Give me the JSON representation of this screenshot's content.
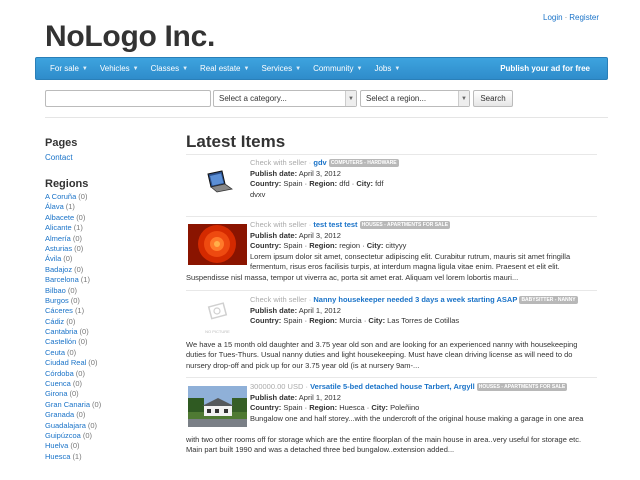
{
  "header": {
    "login": "Login",
    "register": "Register",
    "brand": "NoLogo Inc."
  },
  "nav": {
    "items": [
      "For sale",
      "Vehicles",
      "Classes",
      "Real estate",
      "Services",
      "Community",
      "Jobs"
    ],
    "publish": "Publish your ad for free"
  },
  "search": {
    "query": "",
    "category_placeholder": "Select a category...",
    "region_placeholder": "Select a region...",
    "button": "Search"
  },
  "sidebar": {
    "pages_heading": "Pages",
    "contact": "Contact",
    "regions_heading": "Regions",
    "regions": [
      {
        "name": "A Coruña",
        "count": "(0)"
      },
      {
        "name": "Álava",
        "count": "(1)"
      },
      {
        "name": "Albacete",
        "count": "(0)"
      },
      {
        "name": "Alicante",
        "count": "(1)"
      },
      {
        "name": "Almería",
        "count": "(0)"
      },
      {
        "name": "Asturias",
        "count": "(0)"
      },
      {
        "name": "Ávila",
        "count": "(0)"
      },
      {
        "name": "Badajoz",
        "count": "(0)"
      },
      {
        "name": "Barcelona",
        "count": "(1)"
      },
      {
        "name": "Bilbao",
        "count": "(0)"
      },
      {
        "name": "Burgos",
        "count": "(0)"
      },
      {
        "name": "Cáceres",
        "count": "(1)"
      },
      {
        "name": "Cádiz",
        "count": "(0)"
      },
      {
        "name": "Cantabria",
        "count": "(0)"
      },
      {
        "name": "Castellón",
        "count": "(0)"
      },
      {
        "name": "Ceuta",
        "count": "(0)"
      },
      {
        "name": "Ciudad Real",
        "count": "(0)"
      },
      {
        "name": "Córdoba",
        "count": "(0)"
      },
      {
        "name": "Cuenca",
        "count": "(0)"
      },
      {
        "name": "Girona",
        "count": "(0)"
      },
      {
        "name": "Gran Canaria",
        "count": "(0)"
      },
      {
        "name": "Granada",
        "count": "(0)"
      },
      {
        "name": "Guadalajara",
        "count": "(0)"
      },
      {
        "name": "Guipúzcoa",
        "count": "(0)"
      },
      {
        "name": "Huelva",
        "count": "(0)"
      },
      {
        "name": "Huesca",
        "count": "(1)"
      }
    ]
  },
  "main": {
    "title": "Latest Items",
    "labels": {
      "publish_date": "Publish date:",
      "country": "Country:",
      "region": "Region:",
      "city": "City:"
    },
    "items": [
      {
        "price": "Check with seller",
        "title": "gdv",
        "category": "COMPUTERS - HARDWARE",
        "date": "April 3, 2012",
        "country": "Spain",
        "region": "dfd",
        "city": "fdf",
        "desc": "dvxv",
        "image": "laptop-photo"
      },
      {
        "price": "Check with seller",
        "title": "test test test",
        "category": "HOUSES - APARTMENTS FOR SALE",
        "date": "April 3, 2012",
        "country": "Spain",
        "region": "region",
        "city": "cittyyy",
        "desc_inline": "Lorem ipsum dolor sit amet, consectetur adipiscing elit. Curabitur rutrum, mauris sit amet fringilla fermentum, risus eros facilisis turpis, at interdum magna ligula vitae enim. Praesent et elit elit.",
        "desc_wide": "Suspendisse nisl massa, tempor ut viverra ac, porta sit amet erat. Aliquam vel lorem lobortis mauri...",
        "image": "red-flower-photo"
      },
      {
        "price": "Check with seller",
        "title": "Nanny housekeeper needed 3 days a week starting ASAP",
        "category": "BABYSITTER - NANNY",
        "date": "April 1, 2012",
        "country": "Spain",
        "region": "Murcia",
        "city": "Las Torres de Cotillas",
        "desc_wide": "We have a 15 month old daughter and 3.75 year old son and are looking for an experienced nanny with housekeeping duties for Tues-Thurs. Usual nanny duties and light housekeeping. Must have clean driving license as will need to do nursery drop-off and pick up for our 3.75 year old (is at nursery 9am-...",
        "image": "no-picture-placeholder",
        "no_picture_text": "NO PICTURE"
      },
      {
        "price": "300000.00 USD",
        "title": "Versatile 5-bed detached house Tarbert, Argyll",
        "category": "HOUSES - APARTMENTS FOR SALE",
        "date": "April 1, 2012",
        "country": "Spain",
        "region": "Huesca",
        "city": "Poleñino",
        "desc_inline": "Bungalow one and half storey...with the undercroft of the original house making a garage in one area",
        "desc_wide": "with two other rooms off for storage which are the entire floorplan of the main house in area..very useful for storage etc. Main part built 1990 and was a detached three bed bungalow..extension added...",
        "image": "house-photo"
      }
    ]
  }
}
